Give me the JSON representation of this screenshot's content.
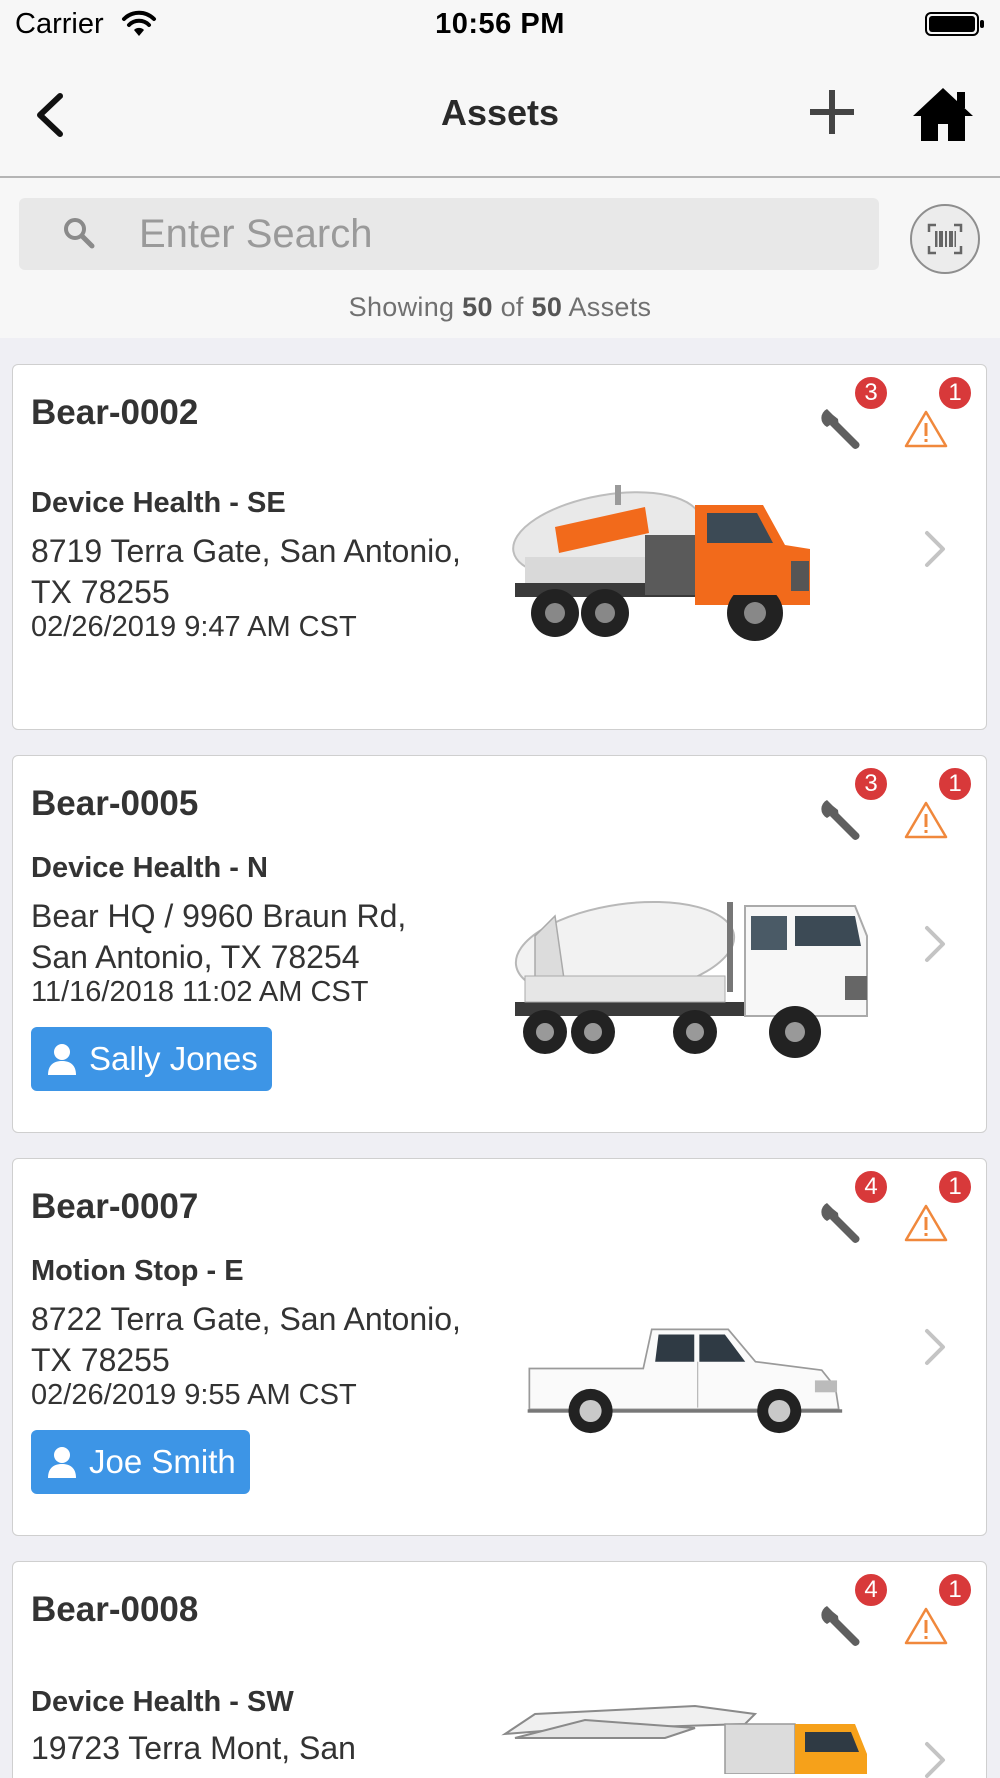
{
  "status_bar": {
    "carrier": "Carrier",
    "time": "10:56 PM"
  },
  "nav": {
    "title": "Assets",
    "back_icon": "chevron-left-icon",
    "add_icon": "plus-icon",
    "home_icon": "home-icon"
  },
  "search": {
    "placeholder": "Enter Search",
    "value": ""
  },
  "summary": {
    "prefix": "Showing",
    "shown": "50",
    "of": "of",
    "total": "50",
    "suffix": "Assets"
  },
  "assets": [
    {
      "name": "Bear-0002",
      "status": "Device Health - SE",
      "address": "8719 Terra Gate, San Antonio, TX 78255",
      "datetime": "02/26/2019 9:47 AM CST",
      "user": "",
      "maintenance_count": "3",
      "alert_count": "1",
      "image": "orange-concrete-mixer-truck"
    },
    {
      "name": "Bear-0005",
      "status": "Device Health - N",
      "address": "Bear HQ / 9960 Braun Rd, San Antonio, TX 78254",
      "datetime": "11/16/2018 11:02 AM CST",
      "user": "Sally Jones",
      "maintenance_count": "3",
      "alert_count": "1",
      "image": "white-concrete-mixer-truck"
    },
    {
      "name": "Bear-0007",
      "status": "Motion Stop - E",
      "address": "8722 Terra Gate, San Antonio, TX 78255",
      "datetime": "02/26/2019 9:55 AM CST",
      "user": "Joe Smith",
      "maintenance_count": "4",
      "alert_count": "1",
      "image": "white-pickup-truck"
    },
    {
      "name": "Bear-0008",
      "status": "Device Health - SW",
      "address": "19723 Terra Mont, San",
      "datetime": "",
      "user": "",
      "maintenance_count": "4",
      "alert_count": "1",
      "image": "concrete-pump-truck"
    }
  ],
  "colors": {
    "accent_blue": "#3d95e6",
    "badge_red": "#d8393a",
    "warning_orange": "#f0883c",
    "truck_orange": "#f26a1b"
  }
}
